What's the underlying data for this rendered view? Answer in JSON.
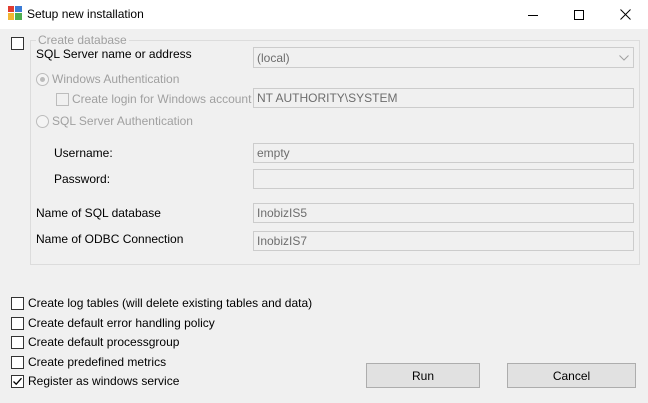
{
  "window": {
    "title": "Setup new installation"
  },
  "create_database": {
    "legend": "Create database",
    "checked": false,
    "server_label": "SQL Server name or address",
    "server_value": "(local)",
    "windows_auth_label": "Windows Authentication",
    "windows_auth_selected": true,
    "create_login_label": "Create login for Windows account",
    "create_login_checked": false,
    "windows_account_value": "NT AUTHORITY\\SYSTEM",
    "sql_auth_label": "SQL Server Authentication",
    "sql_auth_selected": false,
    "username_label": "Username:",
    "username_value": "empty",
    "password_label": "Password:",
    "password_value": "",
    "db_name_label": "Name of SQL database",
    "db_name_value": "InobizIS5",
    "odbc_label": "Name of ODBC Connection",
    "odbc_value": "InobizIS7"
  },
  "options": [
    {
      "label": "Create log tables (will delete existing tables and data)",
      "checked": false
    },
    {
      "label": "Create default error handling policy",
      "checked": false
    },
    {
      "label": "Create default processgroup",
      "checked": false
    },
    {
      "label": "Create predefined metrics",
      "checked": false
    },
    {
      "label": "Register as windows service",
      "checked": true
    }
  ],
  "buttons": {
    "run": "Run",
    "cancel": "Cancel"
  },
  "icons": {
    "app": "setup-icon",
    "minimize": "minimize-icon",
    "maximize": "maximize-icon",
    "close": "close-icon",
    "dropdown": "chevron-down-icon",
    "check": "checkmark-icon"
  }
}
